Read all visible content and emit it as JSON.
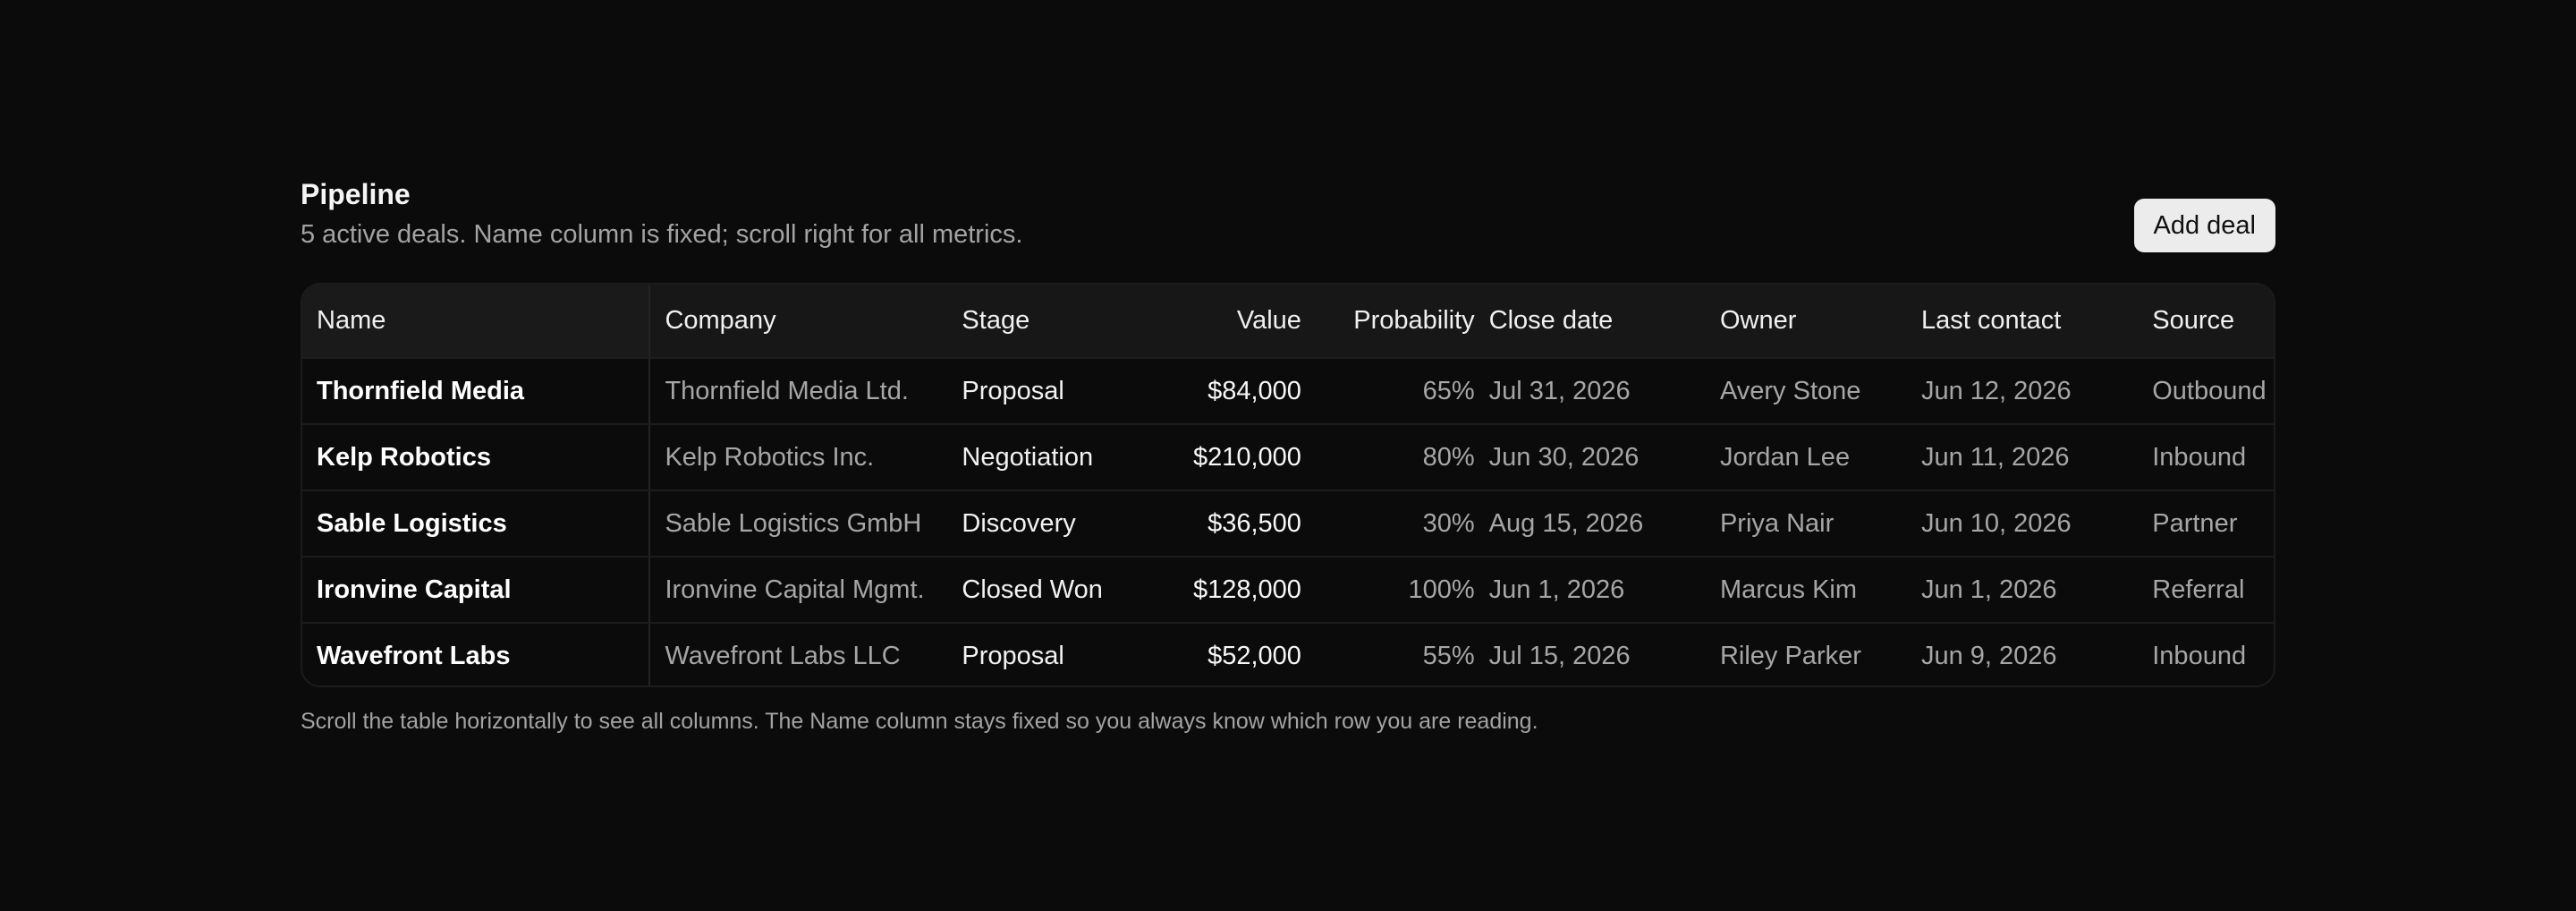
{
  "header": {
    "title": "Pipeline",
    "subtitle": "5 active deals. Name column is fixed; scroll right for all metrics.",
    "add_button_label": "Add deal"
  },
  "table": {
    "columns": {
      "name": "Name",
      "company": "Company",
      "stage": "Stage",
      "value": "Value",
      "probability": "Probability",
      "close_date": "Close date",
      "owner": "Owner",
      "last_contact": "Last contact",
      "source": "Source"
    },
    "rows": [
      {
        "name": "Thornfield Media",
        "company": "Thornfield Media Ltd.",
        "stage": "Proposal",
        "value": "$84,000",
        "probability": "65%",
        "close_date": "Jul 31, 2026",
        "owner": "Avery Stone",
        "last_contact": "Jun 12, 2026",
        "source": "Outbound"
      },
      {
        "name": "Kelp Robotics",
        "company": "Kelp Robotics Inc.",
        "stage": "Negotiation",
        "value": "$210,000",
        "probability": "80%",
        "close_date": "Jun 30, 2026",
        "owner": "Jordan Lee",
        "last_contact": "Jun 11, 2026",
        "source": "Inbound"
      },
      {
        "name": "Sable Logistics",
        "company": "Sable Logistics GmbH",
        "stage": "Discovery",
        "value": "$36,500",
        "probability": "30%",
        "close_date": "Aug 15, 2026",
        "owner": "Priya Nair",
        "last_contact": "Jun 10, 2026",
        "source": "Partner"
      },
      {
        "name": "Ironvine Capital",
        "company": "Ironvine Capital Mgmt.",
        "stage": "Closed Won",
        "value": "$128,000",
        "probability": "100%",
        "close_date": "Jun 1, 2026",
        "owner": "Marcus Kim",
        "last_contact": "Jun 1, 2026",
        "source": "Referral"
      },
      {
        "name": "Wavefront Labs",
        "company": "Wavefront Labs LLC",
        "stage": "Proposal",
        "value": "$52,000",
        "probability": "55%",
        "close_date": "Jul 15, 2026",
        "owner": "Riley Parker",
        "last_contact": "Jun 9, 2026",
        "source": "Inbound"
      }
    ]
  },
  "footnote": "Scroll the table horizontally to see all columns. The Name column stays fixed so you always know which row you are reading.",
  "colors": {
    "background": "#0b0b0b",
    "header_row": "#171717",
    "button_bg": "#ececec",
    "muted_text": "#a3a3a3"
  }
}
